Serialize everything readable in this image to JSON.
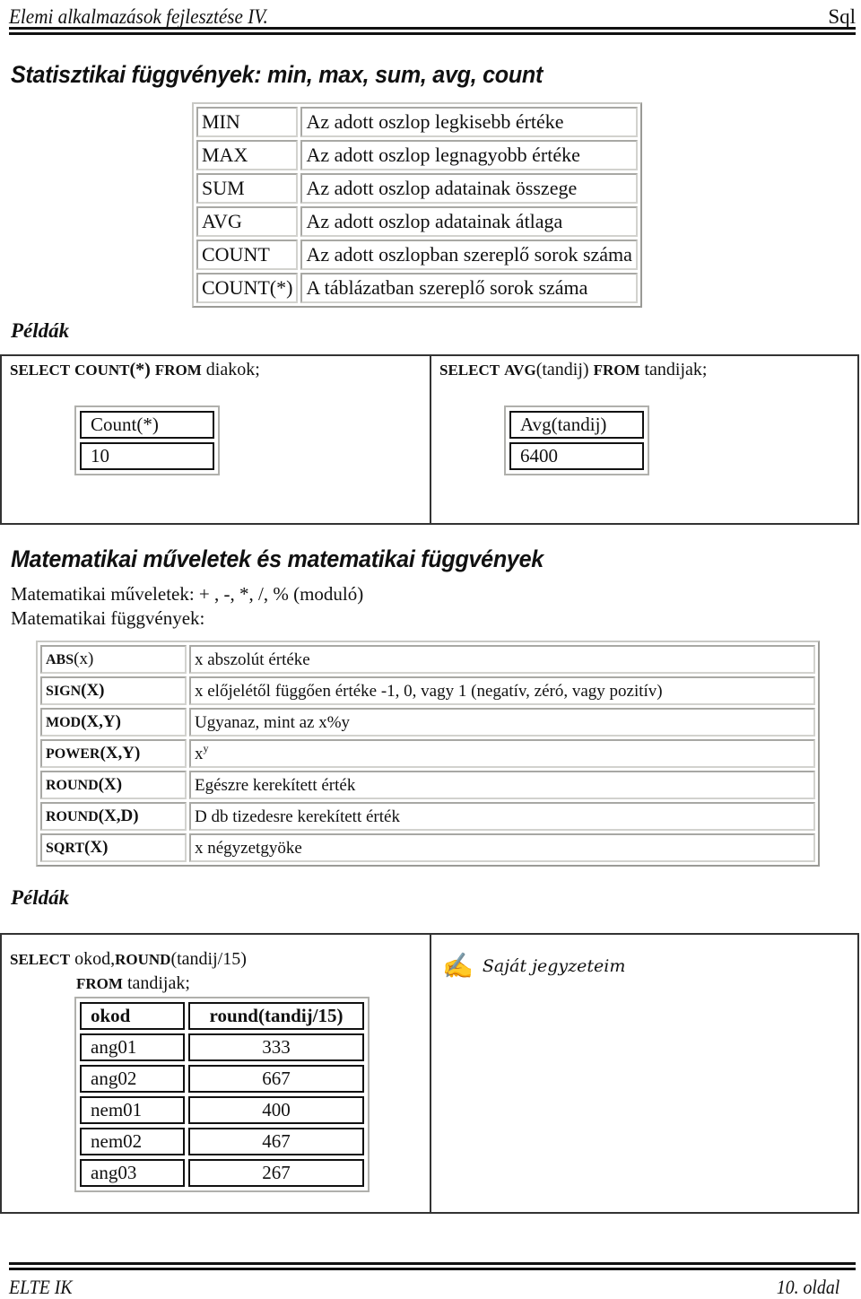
{
  "header": {
    "left": "Elemi alkalmazások fejlesztése IV.",
    "right": "Sql"
  },
  "section_stat": {
    "title": "Statisztikai függvények: min, max, sum, avg, count",
    "rows": [
      {
        "fn": "MIN",
        "desc": "Az adott oszlop legkisebb értéke"
      },
      {
        "fn": "MAX",
        "desc": "Az adott oszlop legnagyobb értéke"
      },
      {
        "fn": "SUM",
        "desc": "Az adott oszlop adatainak összege"
      },
      {
        "fn": "AVG",
        "desc": "Az adott oszlop adatainak átlaga"
      },
      {
        "fn": "COUNT",
        "desc": "Az adott oszlopban szereplő sorok száma"
      },
      {
        "fn": "COUNT(*)",
        "desc": "A táblázatban szereplő sorok száma"
      }
    ],
    "examples_label": "Példák",
    "example_left": {
      "kw_select": "SELECT",
      "kw_count": "COUNT",
      "count_arg": "(*)",
      "kw_from": "FROM",
      "table": "diakok;",
      "result_header": "Count(*)",
      "result_value": "10"
    },
    "example_right": {
      "kw_select": "SELECT",
      "kw_avg": "AVG",
      "avg_arg": "(tandij)",
      "kw_from": "FROM",
      "table": "tandijak;",
      "result_header": "Avg(tandij)",
      "result_value": "6400"
    }
  },
  "section_math": {
    "title": "Matematikai műveletek és matematikai függvények",
    "ops_line": "Matematikai műveletek: + , -, *, /, % (moduló)",
    "funcs_line": "Matematikai függvények:",
    "rows": [
      {
        "name": "ABS",
        "args": "(x)",
        "desc": "x abszolút értéke"
      },
      {
        "name": "SIGN",
        "args": "(X)",
        "desc": "x előjelétől függően értéke -1, 0, vagy 1 (negatív, zéró, vagy pozitív)"
      },
      {
        "name": "MOD",
        "args": "(X,Y)",
        "desc": "Ugyanaz, mint az x%y"
      },
      {
        "name": "POWER",
        "args": "(X,Y)",
        "desc": "x",
        "sup": "y"
      },
      {
        "name": "ROUND",
        "args": "(X)",
        "desc": "Egészre kerekített érték"
      },
      {
        "name": "ROUND",
        "args": "(X,D)",
        "desc": "D db tizedesre kerekített érték"
      },
      {
        "name": "SQRT",
        "args": "(X)",
        "desc": "x négyzetgyöke"
      }
    ],
    "examples_label": "Példák",
    "example": {
      "kw_select": "SELECT",
      "cols": "okod,",
      "kw_round": "ROUND",
      "round_arg": "(tandij/15)",
      "kw_from": "FROM",
      "table": "tandijak;",
      "result_headers": [
        "okod",
        "round(tandij/15)"
      ],
      "result_rows": [
        [
          "ang01",
          "333"
        ],
        [
          "ang02",
          "667"
        ],
        [
          "nem01",
          "400"
        ],
        [
          "nem02",
          "467"
        ],
        [
          "ang03",
          "267"
        ]
      ]
    },
    "notes": {
      "icon": "writing-hand-icon",
      "glyph": "✍",
      "label": "Saját jegyzeteim"
    }
  },
  "footer": {
    "left": "ELTE IK",
    "right": "10. oldal"
  }
}
